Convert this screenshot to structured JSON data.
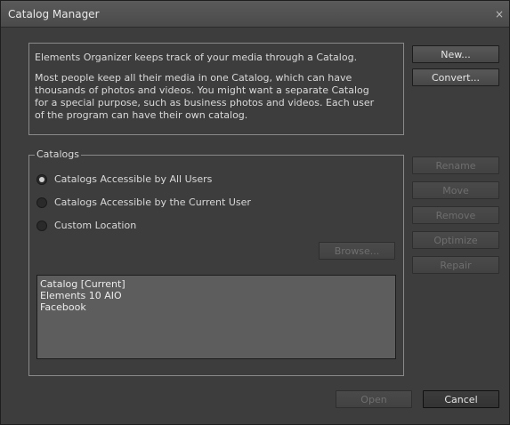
{
  "window": {
    "title": "Catalog Manager",
    "close_glyph": "×"
  },
  "info": {
    "line1": "Elements Organizer keeps track of your media through a Catalog.",
    "paragraph_lines": [
      "Most people keep all their media in one Catalog, which can have",
      "thousands of photos and videos. You might want a separate Catalog",
      "for a special purpose, such as business photos and videos. Each user",
      "of the program can have their own catalog."
    ]
  },
  "top_buttons": {
    "new_label": "New...",
    "convert_label": "Convert..."
  },
  "catalogs": {
    "legend": "Catalogs",
    "options": [
      {
        "label": "Catalogs Accessible by All Users",
        "checked": true
      },
      {
        "label": "Catalogs Accessible by the Current User",
        "checked": false
      },
      {
        "label": "Custom Location",
        "checked": false
      }
    ],
    "browse_label": "Browse...",
    "items": [
      "Catalog [Current]",
      "Elements 10 AIO",
      "Facebook"
    ]
  },
  "side_buttons": {
    "rename_label": "Rename",
    "move_label": "Move",
    "remove_label": "Remove",
    "optimize_label": "Optimize",
    "repair_label": "Repair"
  },
  "footer": {
    "open_label": "Open",
    "cancel_label": "Cancel"
  }
}
